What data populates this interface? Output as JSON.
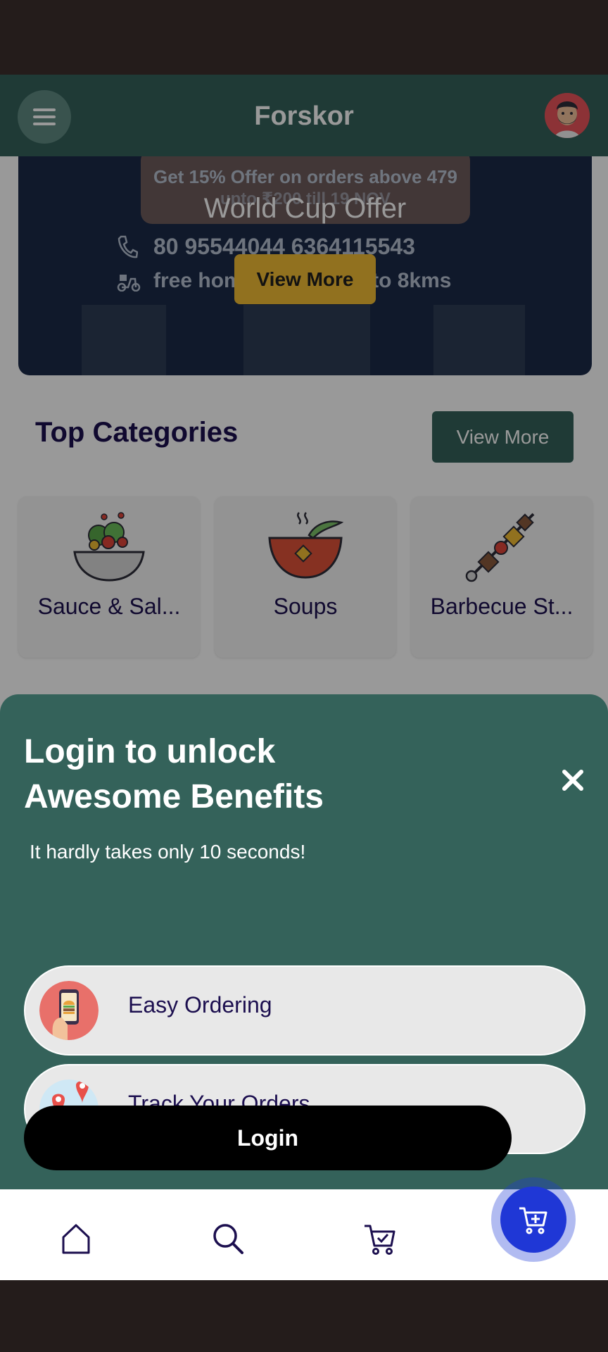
{
  "header": {
    "app_title": "Forskor"
  },
  "banner": {
    "offer_line1": "Get 15% Offer on orders above 479",
    "offer_line2": "upto ₹200 till 19 NOV",
    "title": "World Cup Offer",
    "phone": "80 95544044 6364115543",
    "delivery": "free home delivery upto 8kms",
    "button_label": "View More"
  },
  "top_categories": {
    "title": "Top Categories",
    "view_more_label": "View More",
    "items": [
      {
        "label": "Sauce & Sal..."
      },
      {
        "label": "Soups"
      },
      {
        "label": "Barbecue St..."
      }
    ]
  },
  "login_sheet": {
    "title": "Login to unlock Awesome Benefits",
    "subtitle": "It hardly takes only 10 seconds!",
    "benefits": [
      {
        "label": "Easy Ordering",
        "icon": "phone-burger-icon"
      },
      {
        "label": "Track Your Orders",
        "icon": "map-pin-icon"
      }
    ],
    "login_label": "Login"
  },
  "bottom_nav": {
    "items": [
      "home-icon",
      "search-icon",
      "cart-check-icon"
    ],
    "fab_icon": "add-to-cart-icon"
  },
  "colors": {
    "primary": "#34625a",
    "accent": "#f2bd34",
    "fab": "#1f37d6",
    "text_dark": "#1c0f4f"
  }
}
